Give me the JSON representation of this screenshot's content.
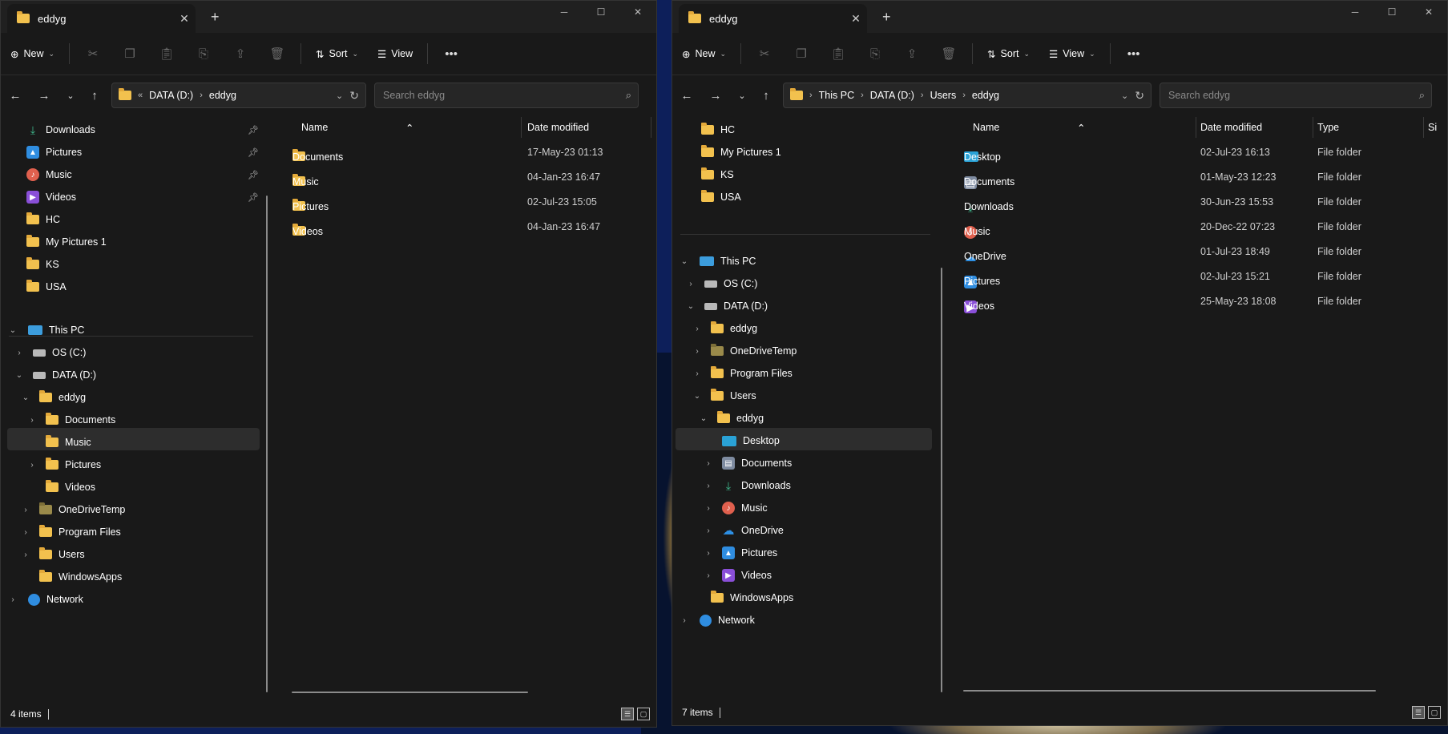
{
  "left": {
    "tab_title": "eddyg",
    "toolbar": {
      "new_label": "New",
      "sort_label": "Sort",
      "view_label": "View"
    },
    "address": {
      "overflow": "«",
      "crumbs": [
        "DATA (D:)",
        "eddyg"
      ]
    },
    "search": {
      "placeholder": "Search eddyg"
    },
    "quick": [
      "Downloads",
      "Pictures",
      "Music",
      "Videos",
      "HC",
      "My Pictures 1",
      "KS",
      "USA"
    ],
    "tree": {
      "this_pc": "This PC",
      "os_c": "OS (C:)",
      "data_d": "DATA (D:)",
      "eddyg": "eddyg",
      "documents": "Documents",
      "music": "Music",
      "pictures": "Pictures",
      "videos": "Videos",
      "onedrivetemp": "OneDriveTemp",
      "program_files": "Program Files",
      "users": "Users",
      "windowsapps": "WindowsApps",
      "network": "Network"
    },
    "columns": {
      "name": "Name",
      "date": "Date modified"
    },
    "files": [
      {
        "name": "Documents",
        "date": "17-May-23 01:13"
      },
      {
        "name": "Music",
        "date": "04-Jan-23 16:47"
      },
      {
        "name": "Pictures",
        "date": "02-Jul-23 15:05"
      },
      {
        "name": "Videos",
        "date": "04-Jan-23 16:47"
      }
    ],
    "status": "4 items"
  },
  "right": {
    "tab_title": "eddyg",
    "toolbar": {
      "new_label": "New",
      "sort_label": "Sort",
      "view_label": "View"
    },
    "address": {
      "crumbs": [
        "This PC",
        "DATA (D:)",
        "Users",
        "eddyg"
      ]
    },
    "search": {
      "placeholder": "Search eddyg"
    },
    "quick": [
      "HC",
      "My Pictures 1",
      "KS",
      "USA"
    ],
    "tree": {
      "this_pc": "This PC",
      "os_c": "OS (C:)",
      "data_d": "DATA (D:)",
      "eddyg": "eddyg",
      "onedrivetemp": "OneDriveTemp",
      "program_files": "Program Files",
      "users": "Users",
      "eddyg_sub": "eddyg",
      "desktop": "Desktop",
      "documents": "Documents",
      "downloads": "Downloads",
      "music": "Music",
      "onedrive": "OneDrive",
      "pictures": "Pictures",
      "videos": "Videos",
      "windowsapps": "WindowsApps",
      "network": "Network"
    },
    "columns": {
      "name": "Name",
      "date": "Date modified",
      "type": "Type",
      "size": "Si"
    },
    "files": [
      {
        "name": "Desktop",
        "date": "02-Jul-23 16:13",
        "type": "File folder"
      },
      {
        "name": "Documents",
        "date": "01-May-23 12:23",
        "type": "File folder"
      },
      {
        "name": "Downloads",
        "date": "30-Jun-23 15:53",
        "type": "File folder"
      },
      {
        "name": "Music",
        "date": "20-Dec-22 07:23",
        "type": "File folder"
      },
      {
        "name": "OneDrive",
        "date": "01-Jul-23 18:49",
        "type": "File folder"
      },
      {
        "name": "Pictures",
        "date": "02-Jul-23 15:21",
        "type": "File folder"
      },
      {
        "name": "Videos",
        "date": "25-May-23 18:08",
        "type": "File folder"
      }
    ],
    "status": "7 items"
  }
}
